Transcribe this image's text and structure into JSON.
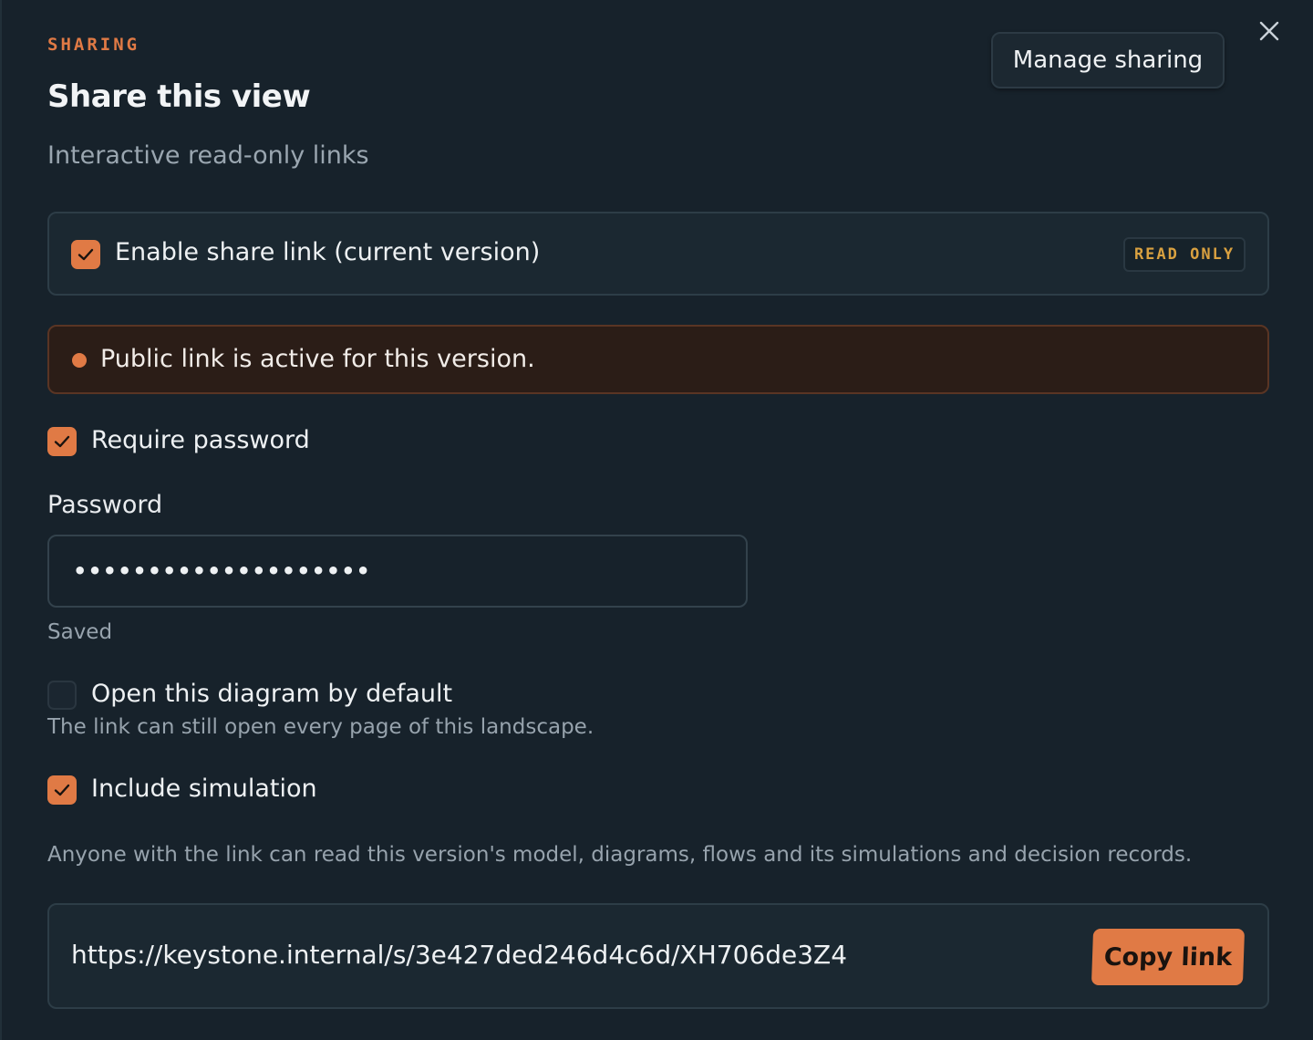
{
  "header": {
    "eyebrow": "SHARING",
    "title": "Share this view",
    "subtitle": "Interactive read-only links",
    "manage_button": "Manage sharing",
    "close_icon": "close-icon"
  },
  "share_link": {
    "checked": true,
    "label": "Enable share link (current version)",
    "badge": "READ ONLY"
  },
  "alert": {
    "text": "Public link is active for this version."
  },
  "require_password": {
    "checked": true,
    "label": "Require password"
  },
  "password": {
    "label": "Password",
    "value": "••••••••••••••••••••",
    "status": "Saved"
  },
  "open_default": {
    "checked": false,
    "label": "Open this diagram by default",
    "hint": "The link can still open every page of this landscape."
  },
  "include_simulation": {
    "checked": true,
    "label": "Include simulation"
  },
  "description": "Anyone with the link can read this version's model, diagrams, flows and its simulations and decision records.",
  "link": {
    "url": "https://keystone.internal/s/3e427ded246d4c6d/XH706de3Z4",
    "copy_button": "Copy link"
  },
  "colors": {
    "accent": "#e07a45",
    "badge": "#d9a140",
    "background": "#17222b"
  }
}
